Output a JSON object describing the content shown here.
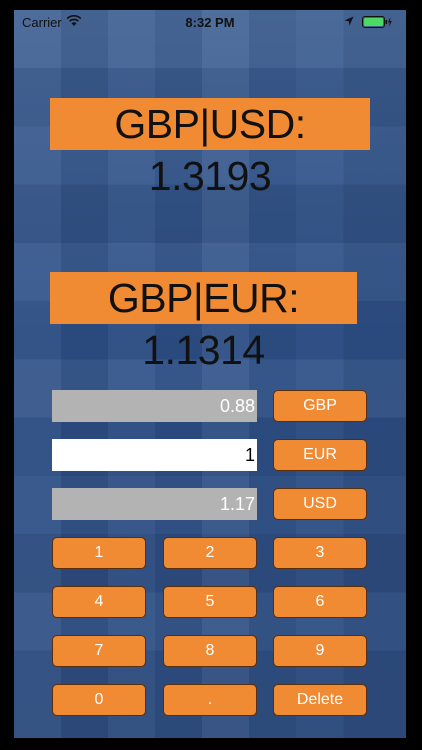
{
  "status_bar": {
    "carrier": "Carrier",
    "time": "8:32 PM"
  },
  "rates": {
    "gbp_usd": "GBP|USD: 1.3193",
    "gbp_eur": "GBP|EUR: 1.1314"
  },
  "fields": {
    "gbp_value": "0.88",
    "eur_value": "1",
    "usd_value": "1.17"
  },
  "currency_buttons": {
    "gbp": "GBP",
    "eur": "EUR",
    "usd": "USD"
  },
  "keypad": {
    "k1": "1",
    "k2": "2",
    "k3": "3",
    "k4": "4",
    "k5": "5",
    "k6": "6",
    "k7": "7",
    "k8": "8",
    "k9": "9",
    "k0": "0",
    "dot": ".",
    "delete": "Delete"
  },
  "colors": {
    "accent": "#f08a33",
    "background": "#2f4f83",
    "field_inactive": "#b3b3b3",
    "field_active": "#ffffff"
  }
}
